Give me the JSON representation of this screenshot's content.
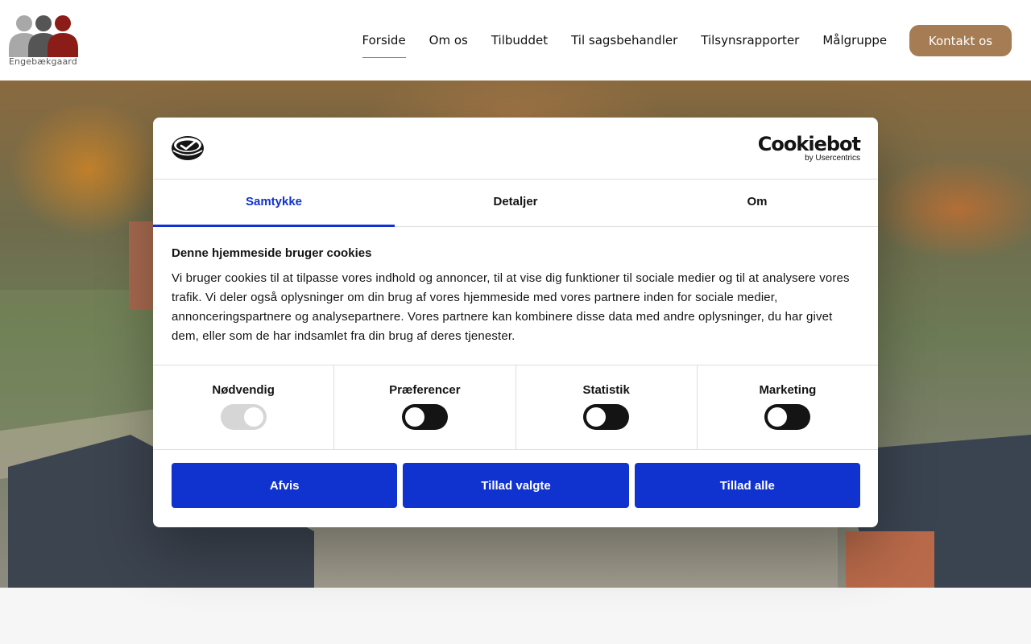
{
  "site": {
    "logo_text": "Engebækgaard",
    "nav": [
      {
        "label": "Forside",
        "active": true
      },
      {
        "label": "Om os"
      },
      {
        "label": "Tilbuddet"
      },
      {
        "label": "Til sagsbehandler"
      },
      {
        "label": "Tilsynsrapporter"
      },
      {
        "label": "Målgruppe"
      }
    ],
    "contact_label": "Kontakt os",
    "colors": {
      "accent": "#a57c53",
      "logo_light": "#a8a8a8",
      "logo_dark": "#555555",
      "logo_red": "#8b1c17"
    }
  },
  "cookie": {
    "brand": "Cookiebot",
    "brand_sub": "by Usercentrics",
    "tabs": [
      "Samtykke",
      "Detaljer",
      "Om"
    ],
    "active_tab": "Samtykke",
    "heading": "Denne hjemmeside bruger cookies",
    "text": "Vi bruger cookies til at tilpasse vores indhold og annoncer, til at vise dig funktioner til sociale medier og til at analysere vores trafik. Vi deler også oplysninger om din brug af vores hjemmeside med vores partnere inden for sociale medier, annonceringspartnere og analysepartnere. Vores partnere kan kombinere disse data med andre oplysninger, du har givet dem, eller som de har indsamlet fra din brug af deres tjenester.",
    "categories": [
      {
        "label": "Nødvendig",
        "state": "on-disabled"
      },
      {
        "label": "Præferencer",
        "state": "off"
      },
      {
        "label": "Statistik",
        "state": "off"
      },
      {
        "label": "Marketing",
        "state": "off"
      }
    ],
    "buttons": {
      "deny": "Afvis",
      "allow_selected": "Tillad valgte",
      "allow_all": "Tillad alle"
    },
    "colors": {
      "primary": "#1032cf",
      "text": "#141414"
    }
  }
}
